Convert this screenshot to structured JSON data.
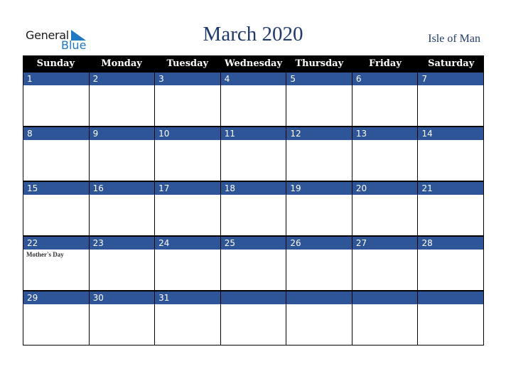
{
  "logo": {
    "line1": "General",
    "line2": "Blue",
    "accent": "#1f78c1"
  },
  "title": "March 2020",
  "region": "Isle of Man",
  "colors": {
    "header_bg": "#000000",
    "week_bar": "#2e5597",
    "title": "#203a6a"
  },
  "weekdays": [
    "Sunday",
    "Monday",
    "Tuesday",
    "Wednesday",
    "Thursday",
    "Friday",
    "Saturday"
  ],
  "weeks": [
    [
      {
        "d": "1"
      },
      {
        "d": "2"
      },
      {
        "d": "3"
      },
      {
        "d": "4"
      },
      {
        "d": "5"
      },
      {
        "d": "6"
      },
      {
        "d": "7"
      }
    ],
    [
      {
        "d": "8"
      },
      {
        "d": "9"
      },
      {
        "d": "10"
      },
      {
        "d": "11"
      },
      {
        "d": "12"
      },
      {
        "d": "13"
      },
      {
        "d": "14"
      }
    ],
    [
      {
        "d": "15"
      },
      {
        "d": "16"
      },
      {
        "d": "17"
      },
      {
        "d": "18"
      },
      {
        "d": "19"
      },
      {
        "d": "20"
      },
      {
        "d": "21"
      }
    ],
    [
      {
        "d": "22",
        "event": "Mother's Day"
      },
      {
        "d": "23"
      },
      {
        "d": "24"
      },
      {
        "d": "25"
      },
      {
        "d": "26"
      },
      {
        "d": "27"
      },
      {
        "d": "28"
      }
    ],
    [
      {
        "d": "29"
      },
      {
        "d": "30"
      },
      {
        "d": "31"
      },
      {
        "d": ""
      },
      {
        "d": ""
      },
      {
        "d": ""
      },
      {
        "d": ""
      }
    ]
  ]
}
